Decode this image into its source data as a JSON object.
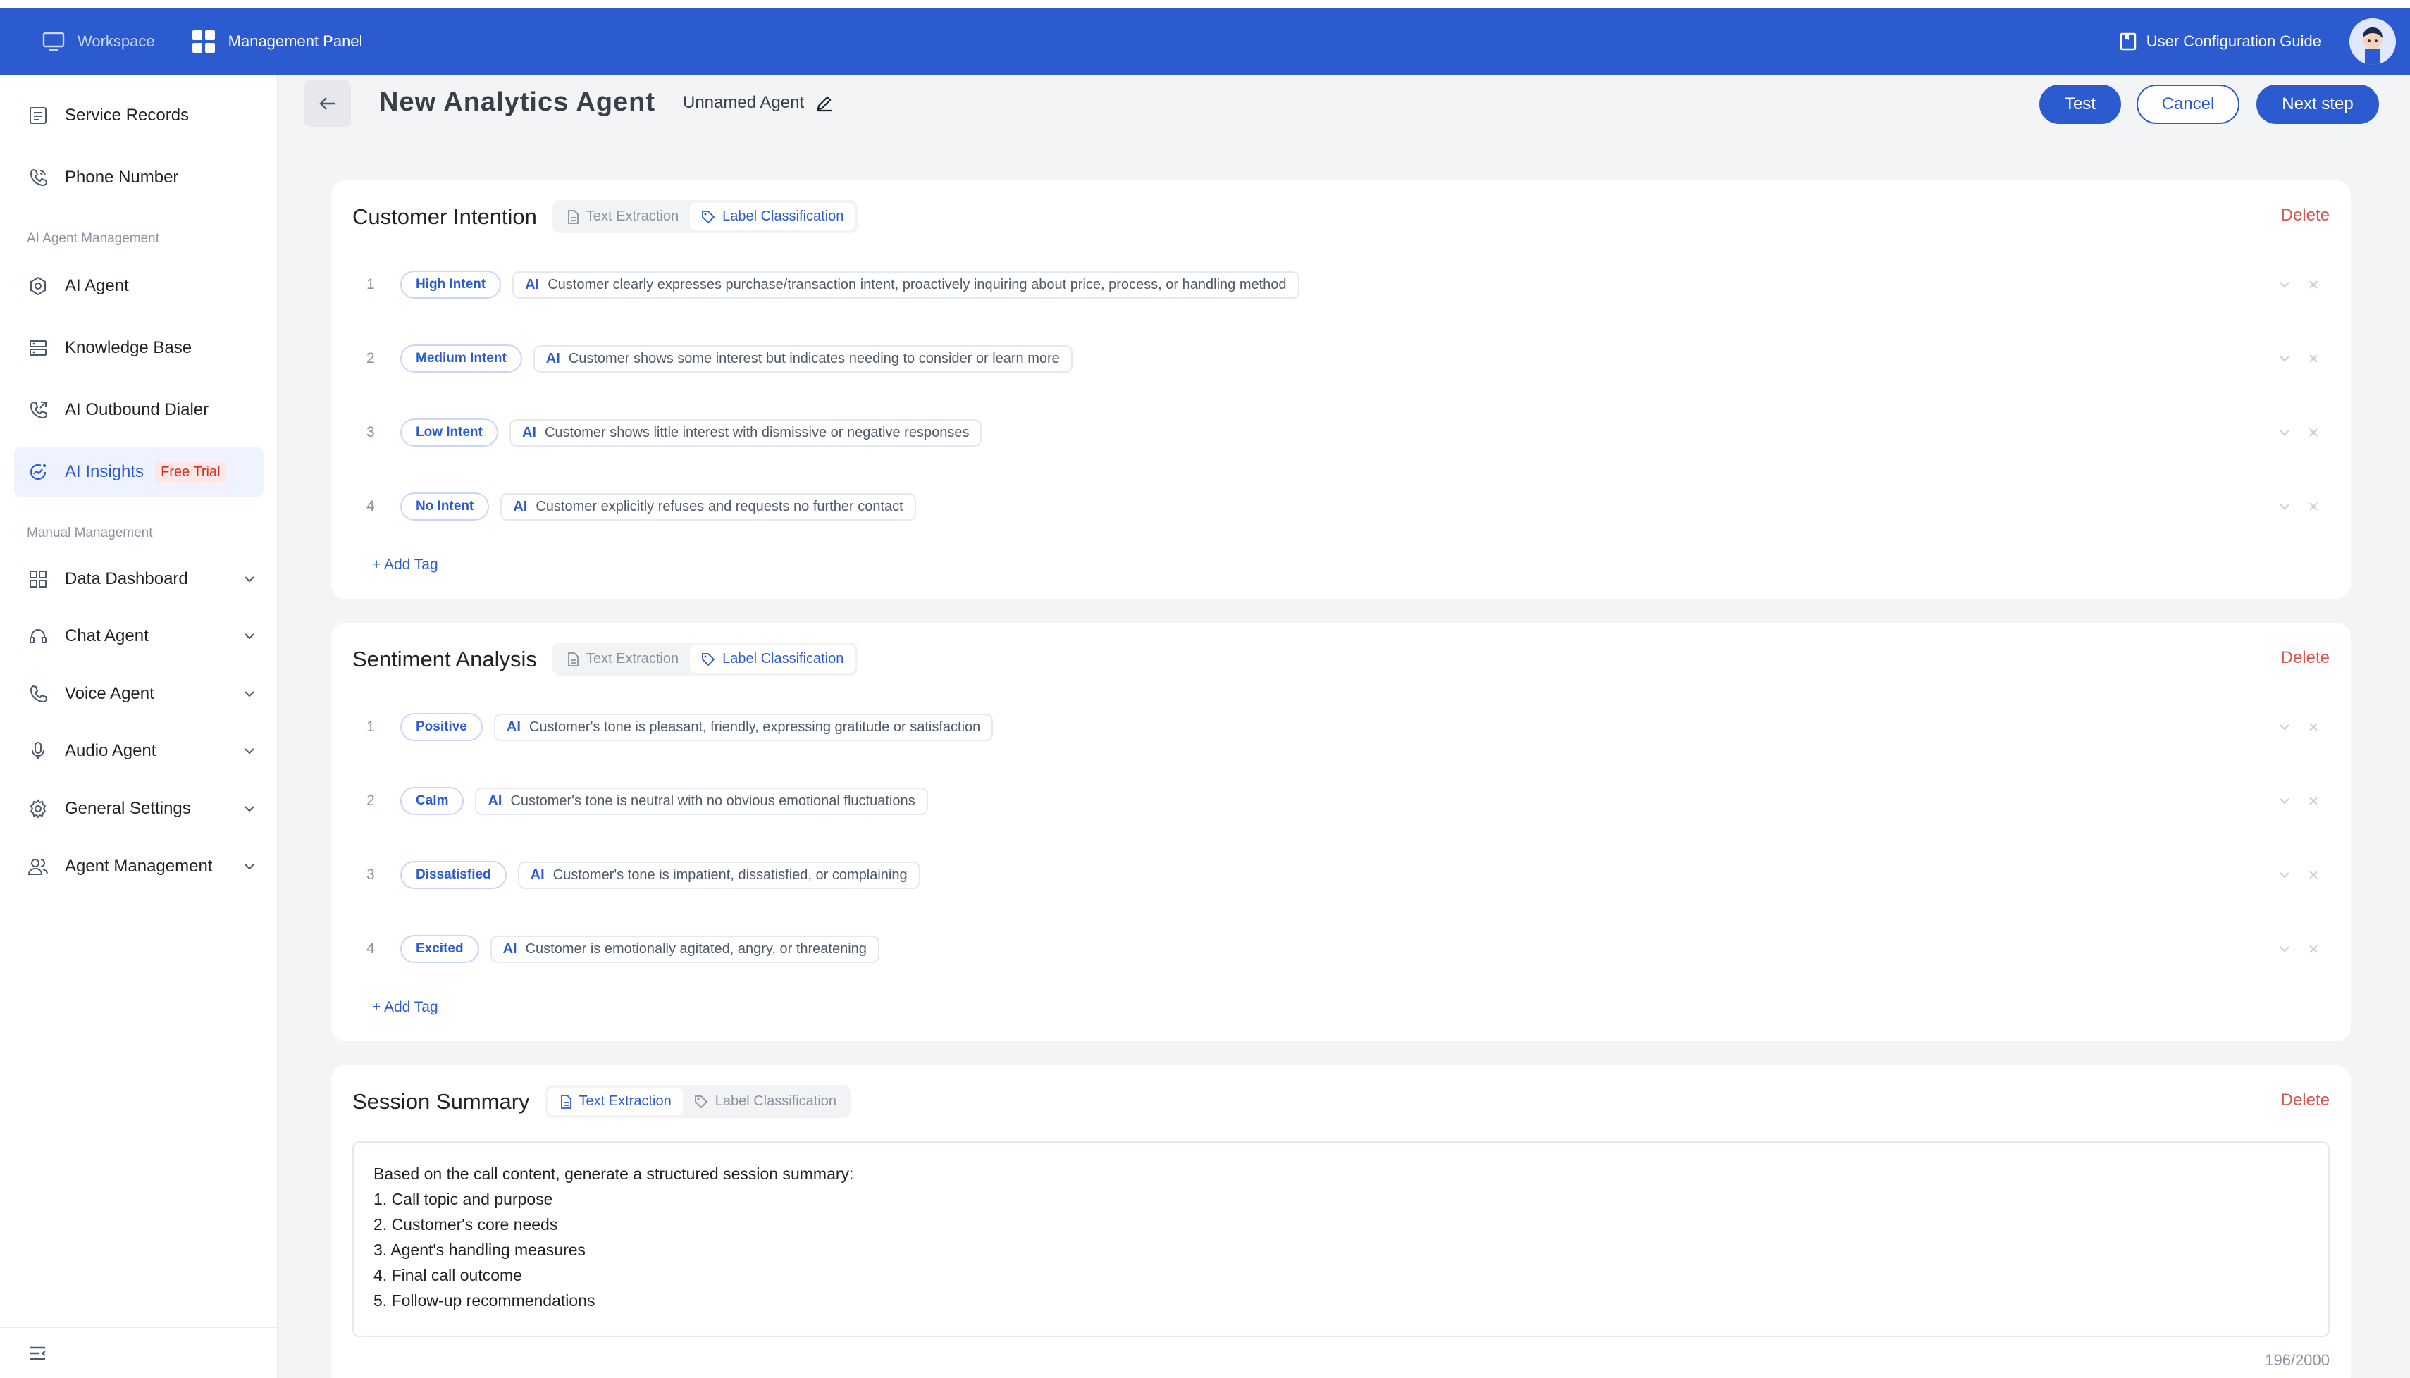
{
  "topbar": {
    "workspace_label": "Workspace",
    "management_label": "Management Panel",
    "guide_label": "User Configuration Guide"
  },
  "sidebar": {
    "service_records": "Service Records",
    "phone_number": "Phone Number",
    "section_ai": "AI Agent Management",
    "ai_agent": "AI Agent",
    "knowledge_base": "Knowledge Base",
    "outbound_dialer": "AI Outbound Dialer",
    "ai_insights": "AI Insights",
    "free_trial": "Free Trial",
    "section_manual": "Manual Management",
    "data_dashboard": "Data Dashboard",
    "chat_agent": "Chat Agent",
    "voice_agent": "Voice Agent",
    "audio_agent": "Audio Agent",
    "general_settings": "General Settings",
    "agent_management": "Agent Management"
  },
  "header": {
    "title": "New Analytics Agent",
    "agent_name": "Unnamed Agent",
    "test_label": "Test",
    "cancel_label": "Cancel",
    "next_label": "Next step"
  },
  "common": {
    "text_extraction": "Text Extraction",
    "label_classification": "Label Classification",
    "delete": "Delete",
    "add_tag": "+ Add Tag",
    "ai": "AI"
  },
  "intention": {
    "title": "Customer Intention",
    "rows": [
      {
        "num": "1",
        "tag": "High Intent",
        "desc": "Customer clearly expresses purchase/transaction intent, proactively inquiring about price, process, or handling method"
      },
      {
        "num": "2",
        "tag": "Medium Intent",
        "desc": "Customer shows some interest but indicates needing to consider or learn more"
      },
      {
        "num": "3",
        "tag": "Low Intent",
        "desc": "Customer shows little interest with dismissive or negative responses"
      },
      {
        "num": "4",
        "tag": "No Intent",
        "desc": "Customer explicitly refuses and requests no further contact"
      }
    ]
  },
  "sentiment": {
    "title": "Sentiment Analysis",
    "rows": [
      {
        "num": "1",
        "tag": "Positive",
        "desc": "Customer's tone is pleasant, friendly, expressing gratitude or satisfaction"
      },
      {
        "num": "2",
        "tag": "Calm",
        "desc": "Customer's tone is neutral with no obvious emotional fluctuations"
      },
      {
        "num": "3",
        "tag": "Dissatisfied",
        "desc": "Customer's tone is impatient, dissatisfied, or complaining"
      },
      {
        "num": "4",
        "tag": "Excited",
        "desc": "Customer is emotionally agitated, angry, or threatening"
      }
    ]
  },
  "summary": {
    "title": "Session Summary",
    "lines": [
      "Based on the call content, generate a structured session summary:",
      "1. Call topic and purpose",
      "2. Customer's core needs",
      "3. Agent's handling measures",
      "4. Final call outcome",
      "5. Follow-up recommendations"
    ],
    "counter": "196/2000"
  },
  "colors": {
    "primary": "#2c5bcf",
    "danger": "#d9534f",
    "trial_bg": "#fde7e7"
  }
}
